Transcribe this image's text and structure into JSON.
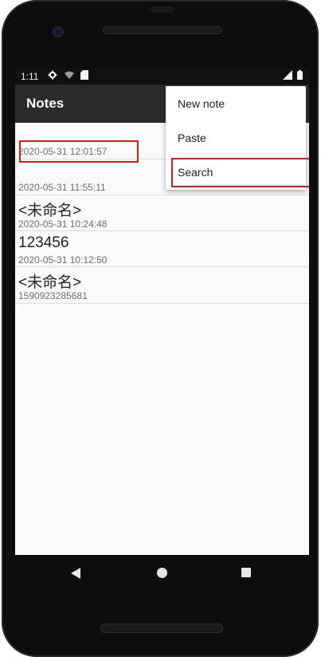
{
  "status_bar": {
    "time": "1:11",
    "icons": [
      "gear-icon",
      "wifi-icon",
      "sd-card-icon",
      "signal-icon",
      "battery-icon"
    ]
  },
  "app_bar": {
    "title": "Notes"
  },
  "overflow_menu": {
    "items": [
      {
        "label": "New note"
      },
      {
        "label": "Paste"
      },
      {
        "label": "Search"
      }
    ]
  },
  "notes": [
    {
      "title": "",
      "date": "2020-05-31 12:01:57"
    },
    {
      "title": "",
      "date": "2020-05-31 11:55:11"
    },
    {
      "title": "<未命名>",
      "date": "2020-05-31 10:24:48"
    },
    {
      "title": "123456",
      "date": "2020-05-31 10:12:50"
    },
    {
      "title": "<未命名>",
      "date": "1590923285681"
    }
  ],
  "colors": {
    "app_bar": "#2b2b2b",
    "status_bar": "#111111",
    "highlight": "#e01b1b",
    "background": "#fafafa"
  }
}
